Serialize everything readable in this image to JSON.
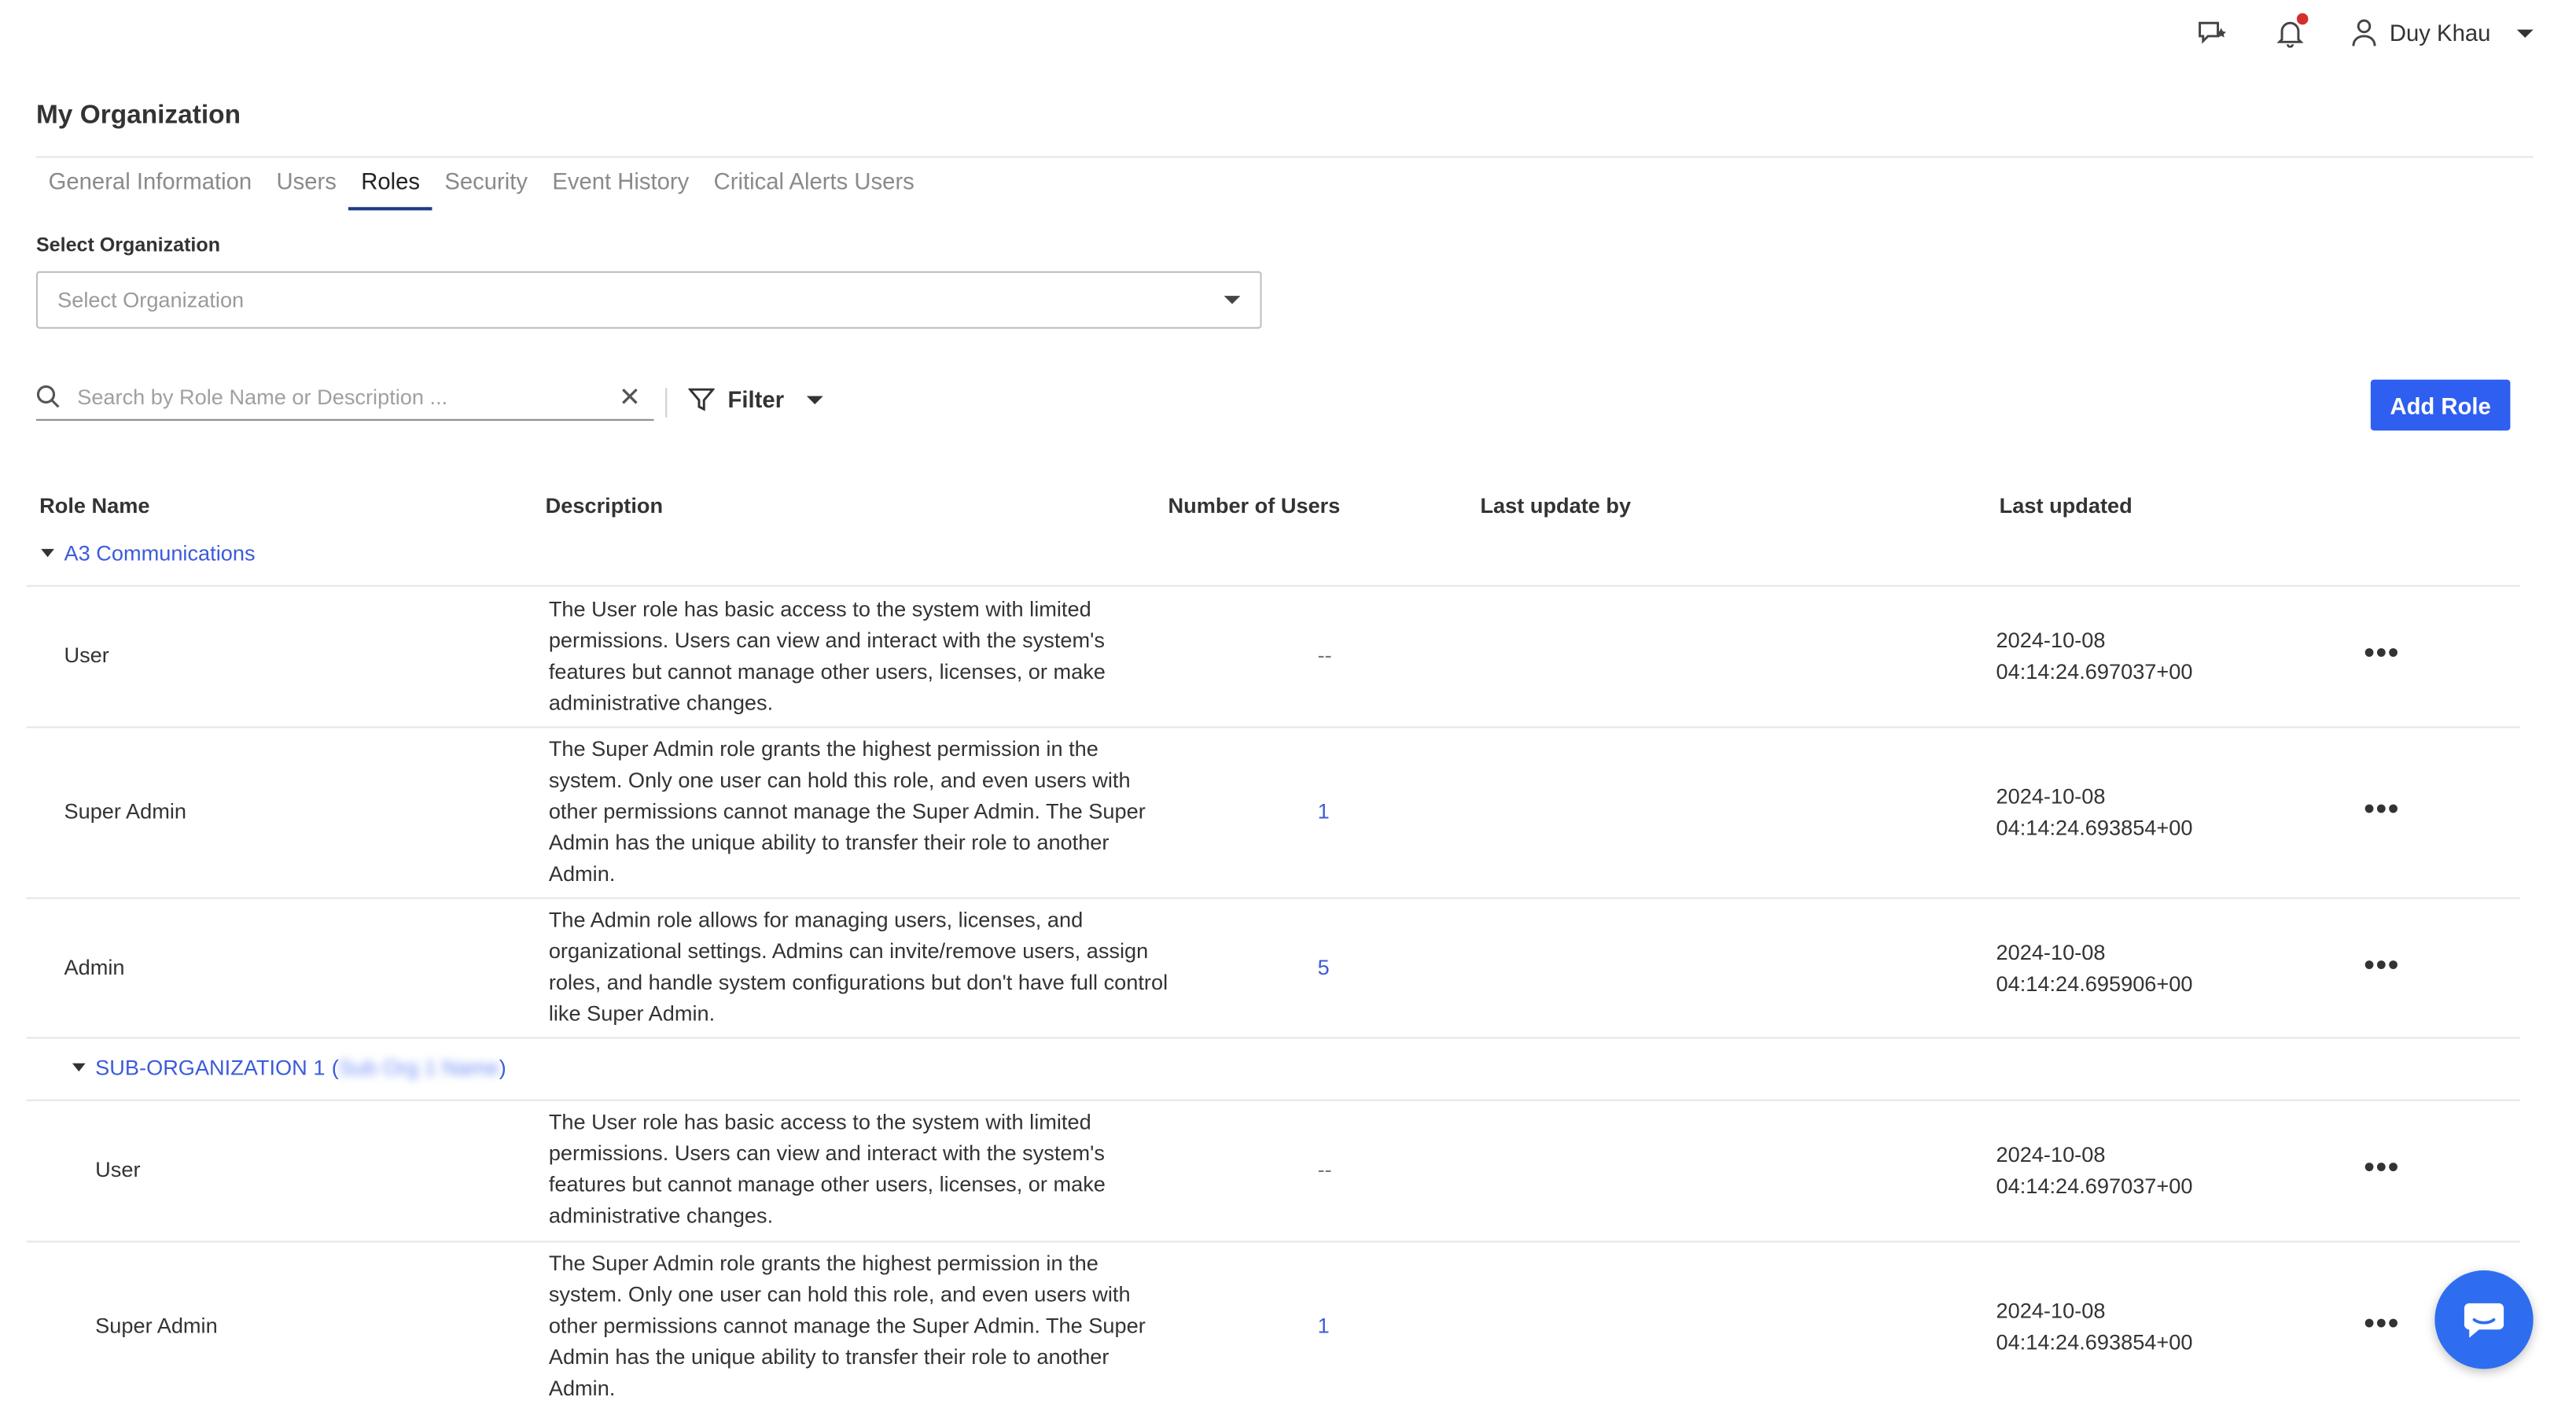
{
  "topbar": {
    "user_name": "Duy Khau"
  },
  "page": {
    "title": "My Organization"
  },
  "tabs": [
    {
      "label": "General Information"
    },
    {
      "label": "Users"
    },
    {
      "label": "Roles"
    },
    {
      "label": "Security"
    },
    {
      "label": "Event History"
    },
    {
      "label": "Critical Alerts Users"
    }
  ],
  "select_org": {
    "label": "Select Organization",
    "placeholder": "Select Organization"
  },
  "search": {
    "placeholder": "Search by Role Name or Description ..."
  },
  "filter": {
    "label": "Filter"
  },
  "add_role": {
    "label": "Add Role"
  },
  "table": {
    "headers": {
      "role_name": "Role Name",
      "description": "Description",
      "number_of_users": "Number of Users",
      "last_update_by": "Last update by",
      "last_updated": "Last updated"
    },
    "groups": [
      {
        "name": "A3 Communications",
        "rows": [
          {
            "name": "User",
            "description": "The User role has basic access to the system with limited permissions. Users can view and interact with the system's features but cannot manage other users, licenses, or make administrative changes.",
            "users": "--",
            "date": "2024-10-08",
            "time": "04:14:24.697037+00"
          },
          {
            "name": "Super Admin",
            "description": "The Super Admin role grants the highest permission in the system. Only one user can hold this role, and even users with other permissions cannot manage the Super Admin. The Super Admin has the unique ability to transfer their role to another Admin.",
            "users": "1",
            "date": "2024-10-08",
            "time": "04:14:24.693854+00"
          },
          {
            "name": "Admin",
            "description": "The Admin role allows for managing users, licenses, and organizational settings. Admins can invite/remove users, assign roles, and handle system configurations but don't have full control like Super Admin.",
            "users": "5",
            "date": "2024-10-08",
            "time": "04:14:24.695906+00"
          }
        ]
      },
      {
        "name": "SUB-ORGANIZATION 1",
        "blurred_suffix": "Sub Org 1 Name",
        "rows": [
          {
            "name": "User",
            "description": "The User role has basic access to the system with limited permissions. Users can view and interact with the system's features but cannot manage other users, licenses, or make administrative changes.",
            "users": "--",
            "date": "2024-10-08",
            "time": "04:14:24.697037+00"
          },
          {
            "name": "Super Admin",
            "description": "The Super Admin role grants the highest permission in the system. Only one user can hold this role, and even users with other permissions cannot manage the Super Admin. The Super Admin has the unique ability to transfer their role to another Admin.",
            "users": "1",
            "date": "2024-10-08",
            "time": "04:14:24.693854+00"
          }
        ]
      }
    ],
    "more_label": "•••"
  },
  "colors": {
    "accent": "#2f5ff0",
    "link": "#3b5bdb",
    "notification": "#d32f2f"
  }
}
